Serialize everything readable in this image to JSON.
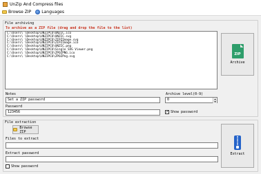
{
  "window": {
    "title": "UnZip And Compress files"
  },
  "menu": {
    "browse_zip": "Browse ZIP",
    "languages": "Languages"
  },
  "archiving": {
    "section_label": "File archiving",
    "hint": "To archive as a ZIP file (drag and drop the file to the list)",
    "files": [
      "C:\\Users\\        \\Desktop\\UNZIPCO\\UNZIC.ico",
      "C:\\Users\\        \\Desktop\\UNZIPCO\\UNZIC.svg",
      "C:\\Users\\        \\Desktop\\UNZIPCO\\ZIPZImage.svg",
      "C:\\Users\\        \\Desktop\\UNZIPCO\\ZIPZImage.ico",
      "C:\\Users\\        \\Desktop\\UNZIPCO\\UNZIC.png",
      "C:\\Users\\        \\Desktop\\UNZIPCO\\Single SVG Viewer.png",
      "C:\\Users\\        \\Desktop\\UNZIPCO\\ZPOZPNG.ico",
      "C:\\Users\\        \\Desktop\\UNZIPCO\\ZPOZPng.svg"
    ],
    "archive_button": "Archive",
    "archive_icon_text": "ZIP",
    "notes_label": "Notes",
    "notes_value": "Set a ZIP password",
    "password_label": "Password",
    "password_value": "123456",
    "level_label": "Archive level(0-9)",
    "level_value": "0",
    "show_password_label": "Show password",
    "show_password_checked": true
  },
  "extraction": {
    "section_label": "File extraction",
    "browse_button": "Browse ZIP",
    "files_label": "Files to extract",
    "files_value": "",
    "password_label": "Extract password",
    "password_value": "",
    "show_password_label": "Show password",
    "show_password_checked": false,
    "extract_button": "Extract"
  }
}
